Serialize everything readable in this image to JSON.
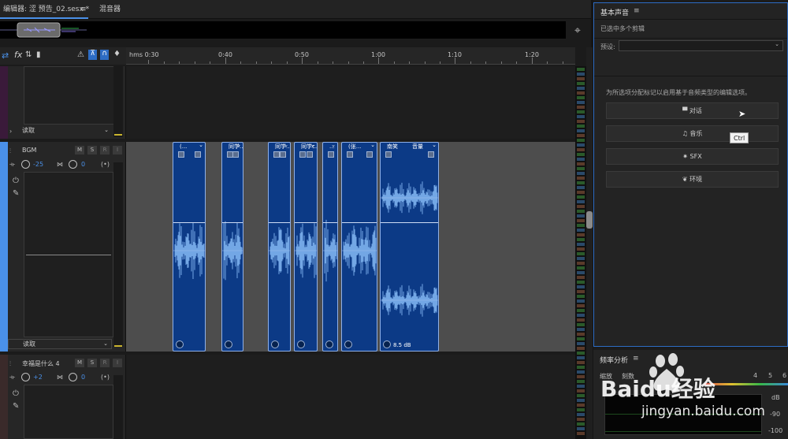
{
  "tabs": {
    "editor": "编辑器: 涩 预告_02.sesx *",
    "menu_glyph": "≡",
    "mixer": "混音器"
  },
  "toolbar": {
    "fx": "fx"
  },
  "ruler": {
    "labels": [
      "hms 0:30",
      "0:40",
      "0:50",
      "1:00",
      "1:10",
      "1:20"
    ]
  },
  "tracks": [
    {
      "read_mode": "读取"
    },
    {
      "name": "BGM",
      "m": "M",
      "s": "S",
      "r": "R",
      "i": "I",
      "volume": "-25",
      "pan": "0",
      "read_mode": "读取"
    },
    {
      "name": "幸福是什么 4",
      "m": "M",
      "s": "S",
      "r": "R",
      "i": "I",
      "volume": "+2",
      "pan": "0"
    }
  ],
  "clips": [
    {
      "label": "(..."
    },
    {
      "label": "同学..."
    },
    {
      "label": "同学..."
    },
    {
      "label": "同学c..."
    },
    {
      "label": "..."
    },
    {
      "label": "(张..."
    },
    {
      "label": "南笑",
      "vol_label": "音量",
      "gain": "8.5 dB"
    }
  ],
  "essential_sound": {
    "title": "基本声音",
    "menu_glyph": "≡",
    "selection": "已选中多个剪辑",
    "preset_label": "预设:",
    "hint": "为所选项分配标记以启用基于音频类型的编辑选项。",
    "buttons": [
      "对话",
      "音乐",
      "SFX",
      "环境"
    ],
    "tooltip": "Ctrl"
  },
  "freq_analysis": {
    "title": "频率分析",
    "menu_glyph": "≡",
    "row_labels": [
      "缩放",
      "刻数"
    ],
    "numbers": [
      "4",
      "5",
      "6"
    ],
    "db_label": "dB",
    "axis": [
      "-90",
      "-100"
    ]
  },
  "watermark": {
    "brand": "Baidu经验",
    "url": "jingyan.baidu.com"
  },
  "colors": {
    "accent": "#2d6cc4",
    "clip_fill": "#0c3a86",
    "waveform": "#7fb4f0",
    "selected_track": "#4a90e8"
  }
}
